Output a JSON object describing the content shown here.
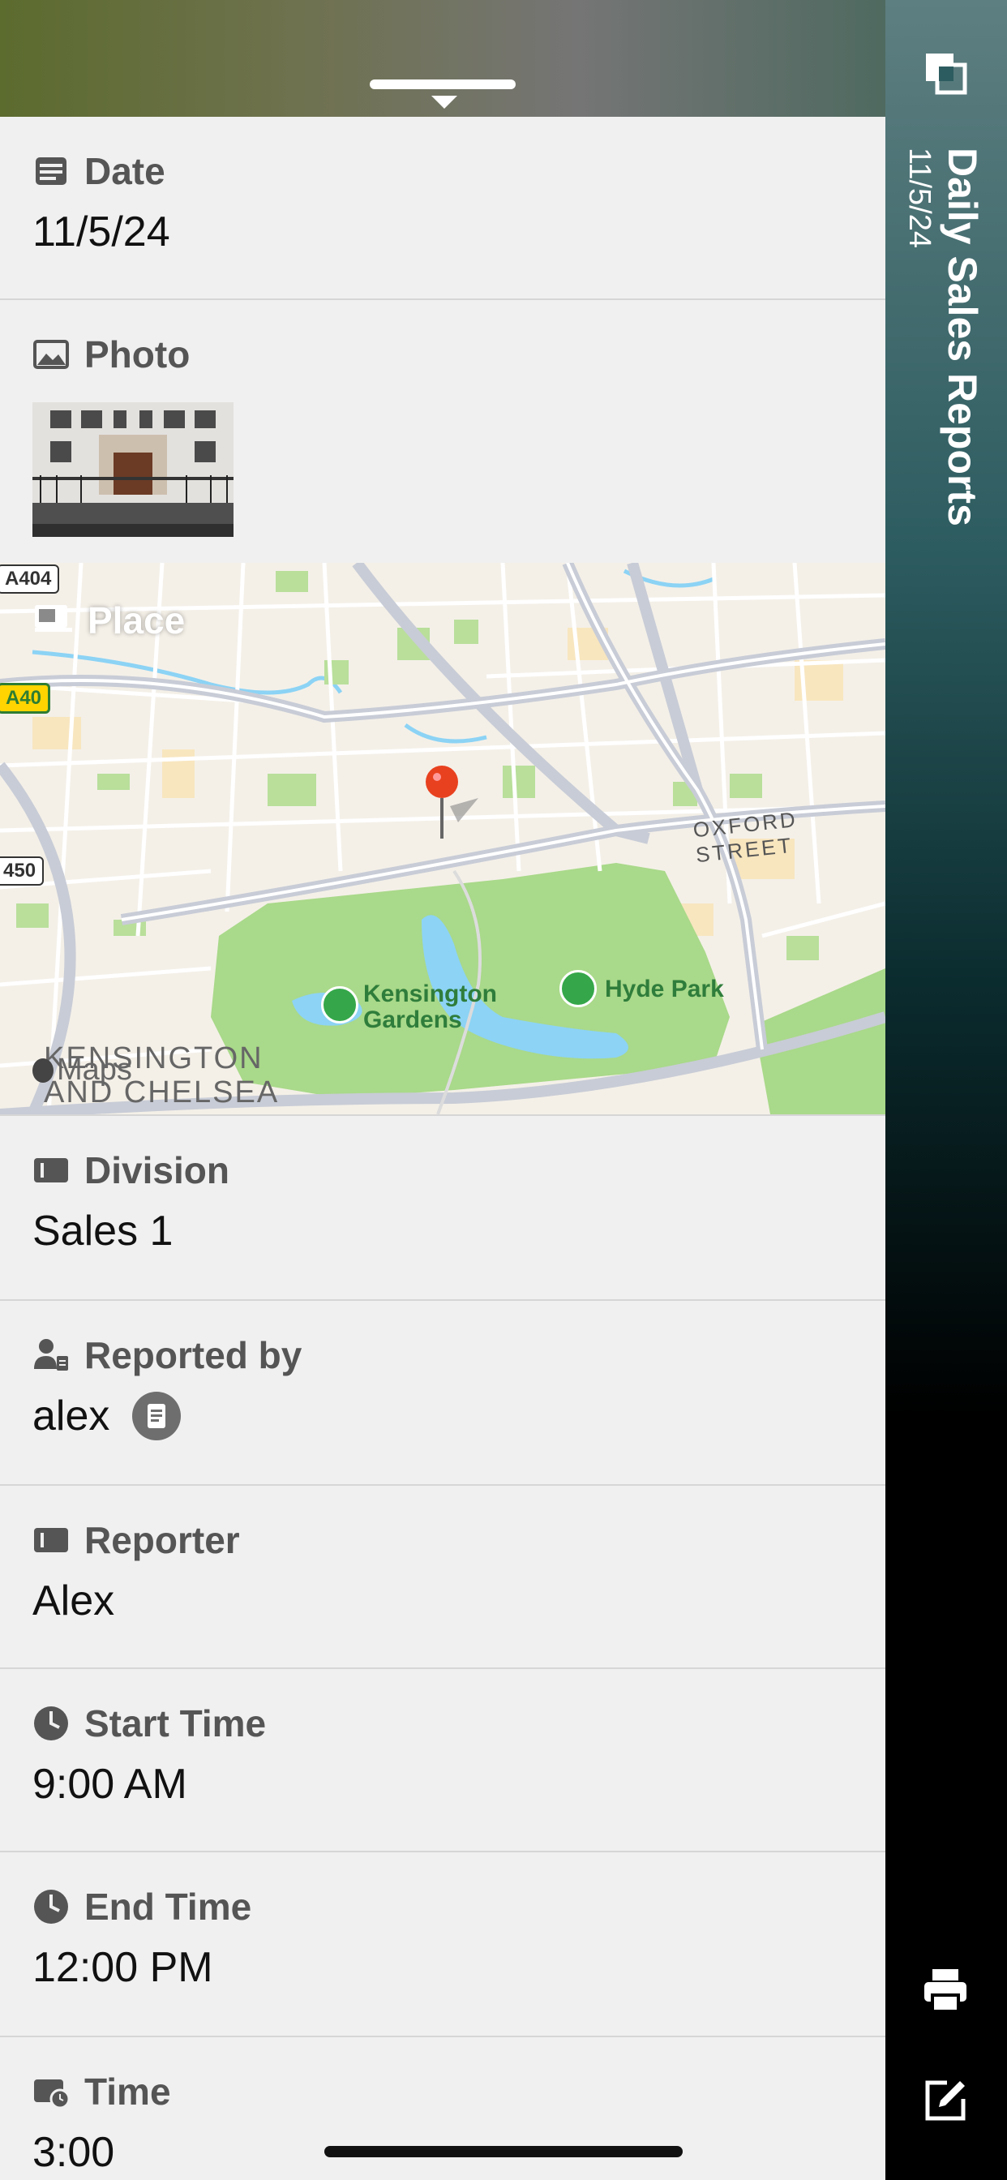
{
  "sidebar": {
    "title": "Daily Sales Reports",
    "subtitle": "11/5/24",
    "top_icon": "layers-icon",
    "print_icon": "printer-icon",
    "edit_icon": "edit-icon"
  },
  "fields": {
    "date": {
      "label": "Date",
      "value": "11/5/24",
      "icon": "calendar-icon"
    },
    "photo": {
      "label": "Photo",
      "icon": "photo-icon"
    },
    "place": {
      "label": "Place",
      "icon": "map-icon",
      "map": {
        "attribution": "Maps",
        "roads": {
          "oxford": "OXFORD STREET"
        },
        "shields": {
          "a404": "A404",
          "a40": "A40",
          "a450": "450"
        },
        "parks": {
          "kensington": "Kensington\nGardens",
          "hyde": "Hyde Park"
        },
        "district": "KENSINGTON\nAND CHELSEA"
      }
    },
    "division": {
      "label": "Division",
      "value": "Sales 1",
      "icon": "text-field-icon"
    },
    "reported_by": {
      "label": "Reported by",
      "value": "alex",
      "icon": "user-icon"
    },
    "reporter": {
      "label": "Reporter",
      "value": "Alex",
      "icon": "text-field-icon"
    },
    "start_time": {
      "label": "Start Time",
      "value": "9:00 AM",
      "icon": "clock-icon"
    },
    "end_time": {
      "label": "End Time",
      "value": "12:00 PM",
      "icon": "clock-icon"
    },
    "time": {
      "label": "Time",
      "value": "3:00",
      "icon": "timer-icon"
    }
  },
  "colors": {
    "label_gray": "#555555",
    "pin_red": "#e8411f",
    "park_green": "#a9d98a",
    "water_blue": "#8cd3f5"
  }
}
